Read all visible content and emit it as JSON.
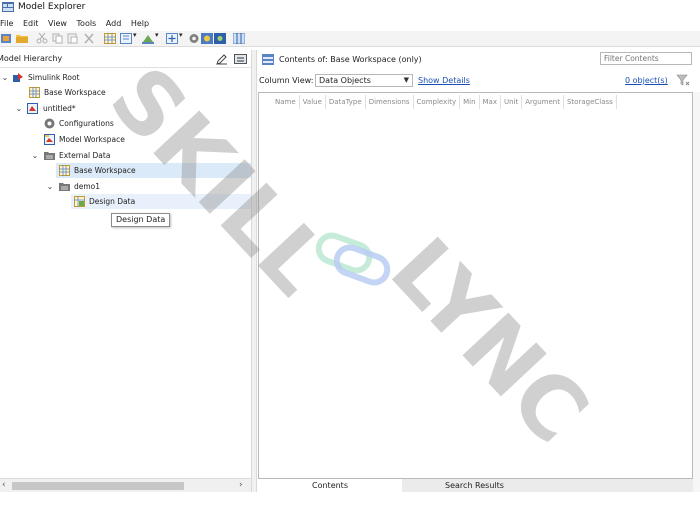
{
  "window": {
    "title": "Model Explorer"
  },
  "menu": {
    "items": [
      "File",
      "Edit",
      "View",
      "Tools",
      "Add",
      "Help"
    ]
  },
  "left_panel": {
    "header": "Model Hierarchy",
    "tree": [
      {
        "label": "Simulink Root",
        "chevron": "⌄"
      },
      {
        "label": "Base Workspace",
        "chevron": ""
      },
      {
        "label": "untitled*",
        "chevron": "⌄"
      },
      {
        "label": "Configurations",
        "chevron": ""
      },
      {
        "label": "Model Workspace",
        "chevron": ""
      },
      {
        "label": "External Data",
        "chevron": "⌄"
      },
      {
        "label": "Base Workspace",
        "chevron": ""
      },
      {
        "label": "demo1",
        "chevron": "⌄"
      },
      {
        "label": "Design Data",
        "chevron": ""
      }
    ],
    "tooltip": "Design Data"
  },
  "right_panel": {
    "contents_of_label": "Contents of:",
    "contents_of_value": "Base Workspace",
    "contents_of_suffix": "(only)",
    "filter_placeholder": "Filter Contents",
    "column_view_label": "Column View:",
    "column_view_value": "Data Objects",
    "show_details": "Show Details",
    "object_count": "0 object(s)",
    "columns": [
      "Name",
      "Value",
      "DataType",
      "Dimensions",
      "Complexity",
      "Min",
      "Max",
      "Unit",
      "Argument",
      "StorageClass"
    ],
    "tabs": [
      "Contents",
      "Search Results"
    ]
  },
  "watermark": {
    "line1": "SKILL",
    "line2": "LYNC"
  }
}
